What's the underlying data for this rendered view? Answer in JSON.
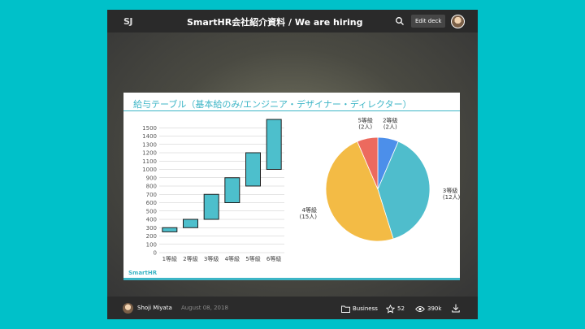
{
  "header": {
    "logo": "SJ",
    "deck_title": "SmartHR会社紹介資料 / We are hiring",
    "edit_label": "Edit deck"
  },
  "slide": {
    "title": "給与テーブル（基本給のみ/エンジニア・デザイナー・ディレクター）",
    "brand": "SmartHR"
  },
  "chart_data": [
    {
      "type": "bar",
      "subtype": "floating-range",
      "categories": [
        "1等級",
        "2等級",
        "3等級",
        "4等級",
        "5等級",
        "6等級"
      ],
      "ranges": [
        [
          250,
          300
        ],
        [
          300,
          400
        ],
        [
          400,
          700
        ],
        [
          600,
          900
        ],
        [
          800,
          1200
        ],
        [
          1000,
          1600
        ]
      ],
      "ytick_labels": [
        "0",
        "100",
        "200",
        "300",
        "400",
        "500",
        "600",
        "700",
        "800",
        "900",
        "1000",
        "1100",
        "1200",
        "1300",
        "1400",
        "1500"
      ],
      "ylim": [
        0,
        1600
      ],
      "grid": true,
      "color": "#4dbfcc"
    },
    {
      "type": "pie",
      "slices": [
        {
          "name": "2等級",
          "label": "(2人)",
          "value": 2,
          "color": "#4c8fea"
        },
        {
          "name": "3等級",
          "label": "(12人)",
          "value": 12,
          "color": "#4fbdcc"
        },
        {
          "name": "4等級",
          "label": "(15人)",
          "value": 15,
          "color": "#f3bb45"
        },
        {
          "name": "5等級",
          "label": "(2人)",
          "value": 2,
          "color": "#ec6a5e"
        }
      ]
    }
  ],
  "footer": {
    "author": "Shoji Miyata",
    "date": "August 08, 2018",
    "category": "Business",
    "stars": "52",
    "views": "390k"
  }
}
